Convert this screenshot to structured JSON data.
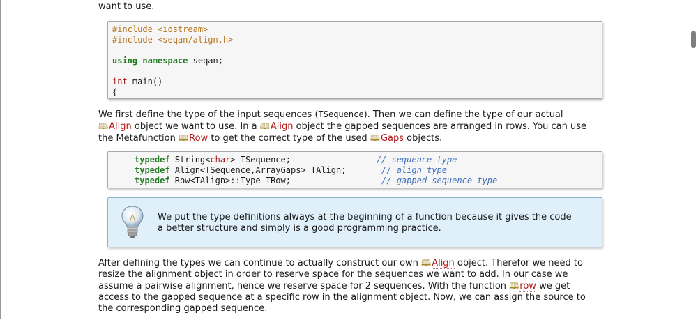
{
  "intro": {
    "text": "want to use."
  },
  "code1": {
    "include1_directive": "#include <iostream>",
    "include2_directive": "#include <seqan/align.h>",
    "using_kw": "using",
    "namespace_kw": "namespace",
    "namespace_name": "seqan;",
    "int_kw": "int",
    "main_sig": "main()",
    "brace": "{"
  },
  "para1": {
    "t1": "We first define the type of the input sequences (",
    "code_tsequence": "TSequence",
    "t2": "). Then we can define the type of our actual",
    "link_align": "Align",
    "t3": " object we want to use. In a ",
    "link_align2": "Align",
    "t4": " object the gapped sequences are arranged in rows. You can use",
    "t5": "the Metafunction ",
    "link_row": "Row",
    "t6": " to get the correct type of the used ",
    "link_gaps": "Gaps",
    "t7": " objects."
  },
  "code2": {
    "typedef_kw": "typedef",
    "line1_a": " String<",
    "line1_char": "char",
    "line1_b": "> TSequence;",
    "line1_pad": "                 ",
    "line1_comment": "// sequence type",
    "line2_a": " Align<TSequence,ArrayGaps> TAlign;",
    "line2_pad": "       ",
    "line2_comment": "// align type",
    "line3_a": " Row<TAlign>::Type TRow;",
    "line3_pad": "                  ",
    "line3_comment": "// gapped sequence type"
  },
  "tip": {
    "icon": "lightbulb-icon",
    "line1": "We put the type definitions always at the beginning of a function because it gives the code",
    "line2": "a better structure and simply is a good programming practice."
  },
  "para3": {
    "t1": "After defining the types we can continue to actually construct our own ",
    "link_align": "Align",
    "t2": " object. Therefor we need to",
    "t3": "resize the alignment object in order to reserve space for the sequences we want to add. In our case we",
    "t4": "assume a pairwise alignment, hence we reserve space for 2 sequences. With the function ",
    "link_row": "row",
    "t5": " we get",
    "t6": "access to the gapped sequence at a specific row in the alignment object. Now, we can assign the source to",
    "t7": "the corresponding gapped sequence."
  },
  "icons": {
    "doc_link": "book-icon",
    "book_glyph": "ὖE"
  },
  "colors": {
    "keyword": "#1f7a1f",
    "preprocessor": "#b8731a",
    "comment": "#3f6fbf",
    "link": "#b21a1a",
    "tip_bg": "#dff0fb"
  }
}
